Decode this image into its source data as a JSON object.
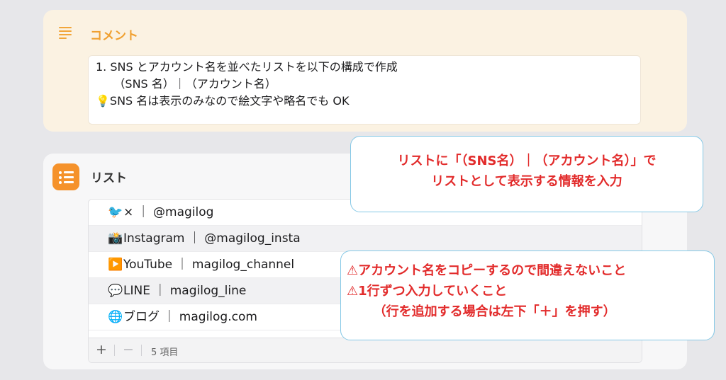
{
  "comment": {
    "title": "コメント",
    "lines": [
      "1. SNS とアカウント名を並べたリストを以下の構成で作成",
      "     （SNS 名）｜（アカウント名）",
      "",
      "💡SNS 名は表示のみなので絵文字や略名でも OK"
    ]
  },
  "list": {
    "title": "リスト",
    "items": [
      {
        "icon": "🐦",
        "text": "× ｜ @magilog"
      },
      {
        "icon": "📸",
        "text": "Instagram ｜ @magilog_insta"
      },
      {
        "icon": "▶️",
        "text": "YouTube ｜ magilog_channel"
      },
      {
        "icon": "💬",
        "text": "LINE ｜ magilog_line"
      },
      {
        "icon": "🌐",
        "text": "ブログ ｜ magilog.com"
      }
    ],
    "footer": {
      "add": "+",
      "remove": "−",
      "count": "5 項目"
    }
  },
  "callouts": {
    "top": [
      "リストに「（SNS名）｜（アカウント名）」で",
      "リストとして表示する情報を入力"
    ],
    "bottom": [
      "⚠アカウント名をコピーするので間違えないこと",
      "⚠1行ずつ入力していくこと",
      "      （行を追加する場合は左下「＋」を押す）"
    ]
  },
  "colors": {
    "accent": "#f5922b",
    "callout_text": "#e22b2b",
    "callout_border": "#85c8e6"
  }
}
